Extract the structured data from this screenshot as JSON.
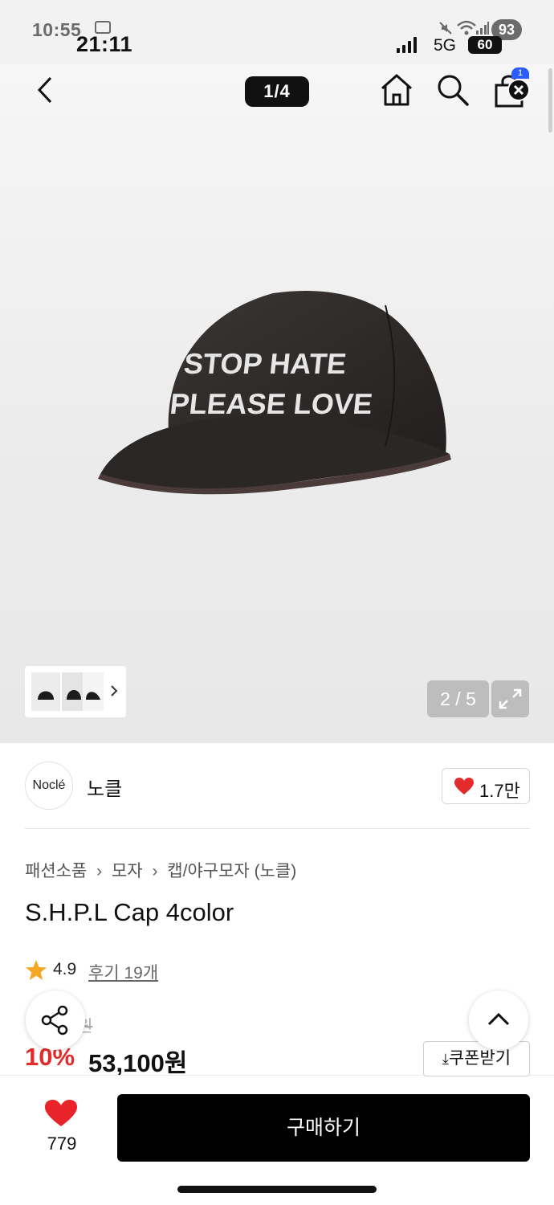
{
  "status_bar": {
    "time_back": "10:55",
    "time_front": "21:11",
    "notification_count": "93",
    "network": "5G",
    "battery": "60"
  },
  "nav": {
    "page_indicator": "1/4",
    "cart_count": "1"
  },
  "gallery": {
    "product_print_line1": "STOP HATE",
    "product_print_line2": "PLEASE LOVE",
    "image_counter": "2 / 5"
  },
  "brand": {
    "logo_text": "Noclé",
    "name": "노클",
    "like_count": "1.7만"
  },
  "product": {
    "breadcrumb": [
      "패션소품",
      "모자",
      "캡/야구모자 (노클)"
    ],
    "title": "S.H.P.L Cap 4color",
    "rating": "4.9",
    "review_label": "후기 19개",
    "original_price_fragment": "원",
    "discount": "10%",
    "sale_price": "53,100원",
    "coupon_label": "쿠폰받기"
  },
  "bottom_bar": {
    "wish_count": "779",
    "buy_label": "구매하기"
  },
  "colors": {
    "accent_red": "#e32b2b",
    "buy_button": "#000000",
    "badge_blue": "#2a5cff"
  }
}
